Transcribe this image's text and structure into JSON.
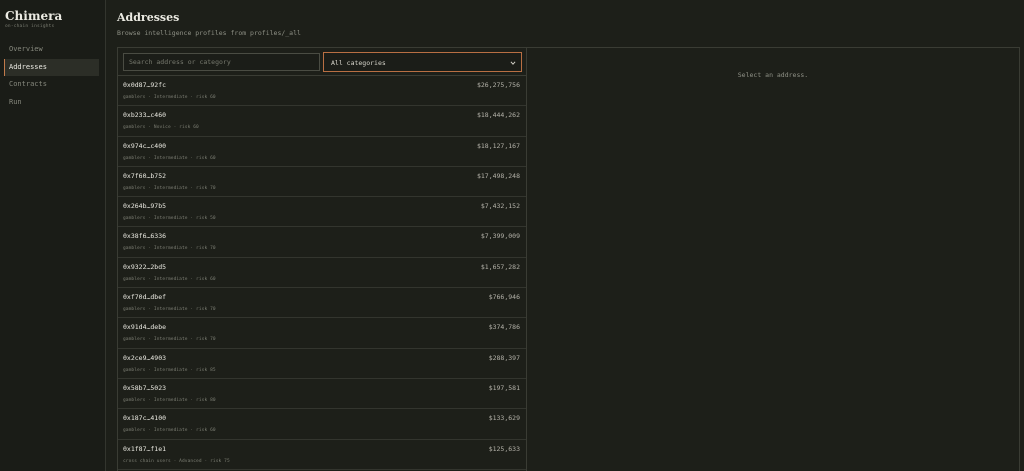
{
  "app": {
    "name": "Chimera",
    "subtitle": "on-chain insights"
  },
  "nav": {
    "items": [
      "Overview",
      "Addresses",
      "Contracts",
      "Run"
    ],
    "active": 1
  },
  "page": {
    "title": "Addresses",
    "subtitle": "Browse intelligence profiles from profiles/_all"
  },
  "filters": {
    "search_placeholder": "Search address or category",
    "category_value": "All categories"
  },
  "rows": [
    {
      "address": "0x0d87…92fc",
      "meta": "gamblers · Intermediate · risk 60",
      "value": "$26,275,756"
    },
    {
      "address": "0xb233…c460",
      "meta": "gamblers · Novice · risk 60",
      "value": "$18,444,262"
    },
    {
      "address": "0x974c…c400",
      "meta": "gamblers · Intermediate · risk 60",
      "value": "$18,127,167"
    },
    {
      "address": "0x7f60…b752",
      "meta": "gamblers · Intermediate · risk 70",
      "value": "$17,498,248"
    },
    {
      "address": "0x264b…97b5",
      "meta": "gamblers · Intermediate · risk 50",
      "value": "$7,432,152"
    },
    {
      "address": "0x38f6…6336",
      "meta": "gamblers · Intermediate · risk 70",
      "value": "$7,399,009"
    },
    {
      "address": "0x9322…2bd5",
      "meta": "gamblers · Intermediate · risk 60",
      "value": "$1,657,282"
    },
    {
      "address": "0xf70d…dbef",
      "meta": "gamblers · Intermediate · risk 70",
      "value": "$766,946"
    },
    {
      "address": "0x91d4…debe",
      "meta": "gamblers · Intermediate · risk 70",
      "value": "$374,786"
    },
    {
      "address": "0x2ce9…4903",
      "meta": "gamblers · Intermediate · risk 85",
      "value": "$288,397"
    },
    {
      "address": "0x58b7…5023",
      "meta": "gamblers · Intermediate · risk 80",
      "value": "$197,581"
    },
    {
      "address": "0x187c…4100",
      "meta": "gamblers · Intermediate · risk 60",
      "value": "$133,629"
    },
    {
      "address": "0x1f87…f1e1",
      "meta": "cross chain users · Advanced · risk 75",
      "value": "$125,633"
    }
  ],
  "detail": {
    "empty_text": "Select an address."
  },
  "colors": {
    "accent": "#c27a4a",
    "background": "#1d1f19",
    "sidebar": "#1a1c17",
    "border": "#3a3c34"
  }
}
